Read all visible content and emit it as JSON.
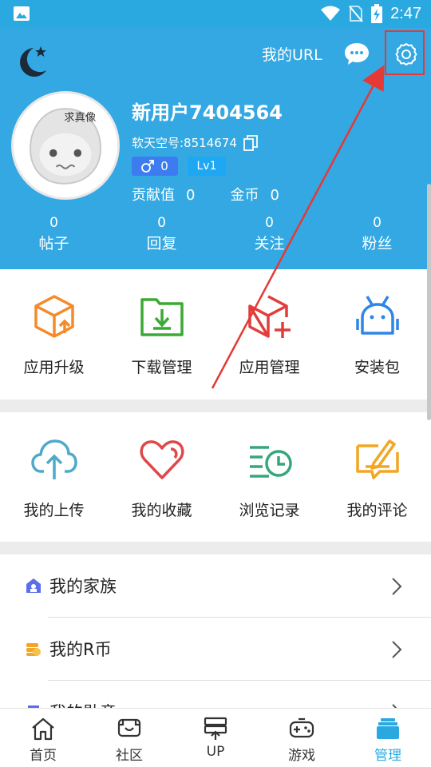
{
  "status_bar": {
    "time": "2:47"
  },
  "header": {
    "url_label": "我的URL",
    "username": "新用户7404564",
    "user_id": "软天空号:8514674",
    "gender_count": "0",
    "level": "Lv1",
    "contribution_label": "贡献值",
    "contribution_value": "0",
    "coins_label": "金币",
    "coins_value": "0",
    "avatar_text": "求真像"
  },
  "counts": [
    {
      "value": "0",
      "label": "帖子"
    },
    {
      "value": "0",
      "label": "回复"
    },
    {
      "value": "0",
      "label": "关注"
    },
    {
      "value": "0",
      "label": "粉丝"
    }
  ],
  "grid1": [
    {
      "label": "应用升级",
      "icon": "box-upgrade-icon",
      "color": "#F58A2A"
    },
    {
      "label": "下载管理",
      "icon": "folder-download-icon",
      "color": "#3BAA34"
    },
    {
      "label": "应用管理",
      "icon": "box-add-icon",
      "color": "#E23C3C"
    },
    {
      "label": "安装包",
      "icon": "android-package-icon",
      "color": "#2E86E6"
    }
  ],
  "grid2": [
    {
      "label": "我的上传",
      "icon": "cloud-upload-icon",
      "color": "#4FA9C9"
    },
    {
      "label": "我的收藏",
      "icon": "heart-icon",
      "color": "#E04848"
    },
    {
      "label": "浏览记录",
      "icon": "history-icon",
      "color": "#37A77A"
    },
    {
      "label": "我的评论",
      "icon": "comment-edit-icon",
      "color": "#F2A623"
    }
  ],
  "list": [
    {
      "label": "我的家族",
      "icon": "family-icon",
      "color": "#5B6FE8"
    },
    {
      "label": "我的R币",
      "icon": "coin-stack-icon",
      "color": "#F2A623"
    },
    {
      "label": "我的勋章",
      "icon": "medal-icon",
      "color": "#5B6FE8"
    }
  ],
  "tabbar": [
    {
      "label": "首页",
      "icon": "home-icon",
      "active": false
    },
    {
      "label": "社区",
      "icon": "community-icon",
      "active": false
    },
    {
      "label": "UP",
      "icon": "up-icon",
      "active": false
    },
    {
      "label": "游戏",
      "icon": "gamepad-icon",
      "active": false
    },
    {
      "label": "管理",
      "icon": "manage-icon",
      "active": true
    }
  ],
  "colors": {
    "primary": "#33A8E2",
    "accent_red": "#E53935"
  }
}
